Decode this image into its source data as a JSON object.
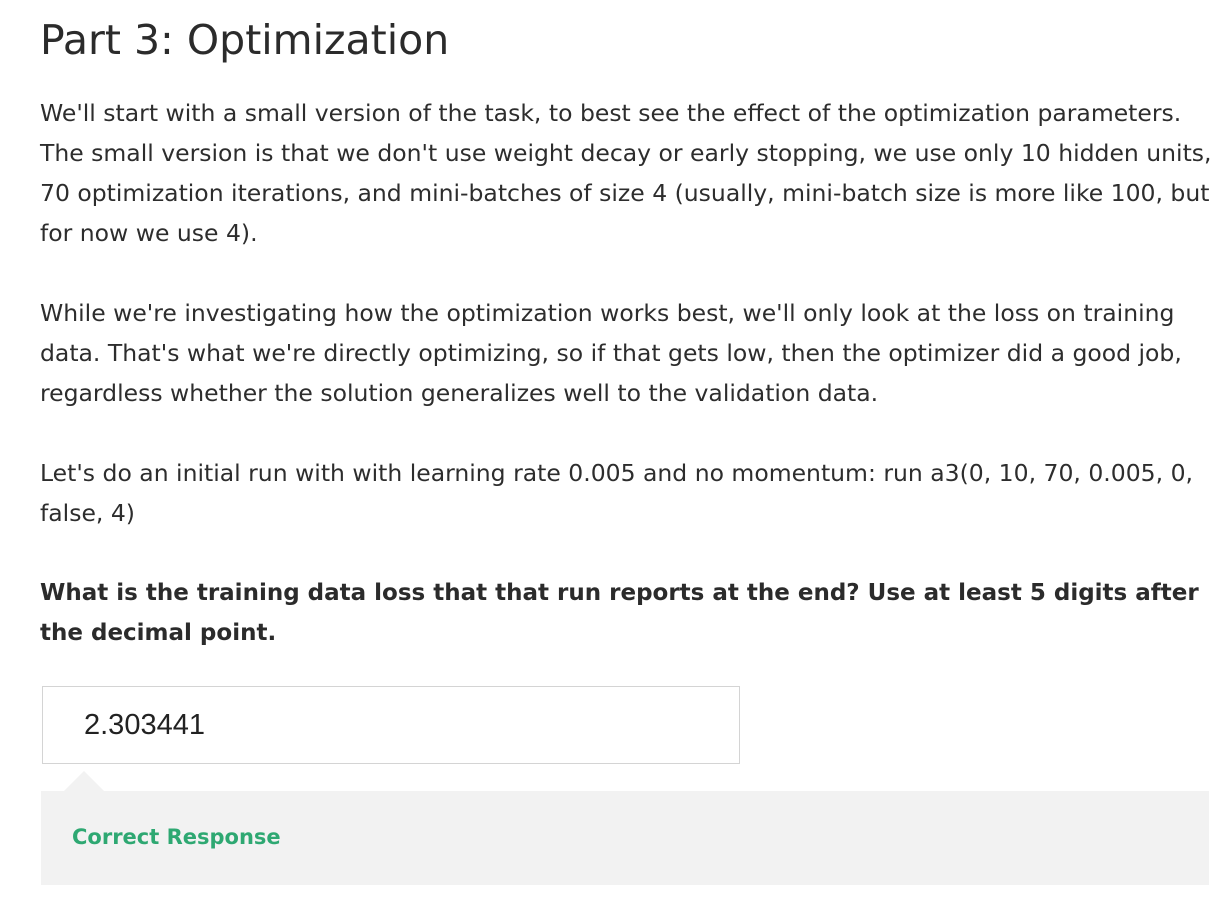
{
  "page": {
    "title": "Part 3: Optimization"
  },
  "content": {
    "paragraph_1": "We'll start with a small version of the task, to best see the effect of the optimization parameters. The small version is that we don't use weight decay or early stopping, we use only 10 hidden units, 70 optimization iterations, and mini-batches of size 4 (usually, mini-batch size is more like 100, but for now we use 4).",
    "paragraph_2": "While we're investigating how the optimization works best, we'll only look at the loss on training data. That's what we're directly optimizing, so if that gets low, then the optimizer did a good job, regardless whether the solution generalizes well to the validation data.",
    "paragraph_3": "Let's do an initial run with with learning rate 0.005 and no momentum: run a3(0, 10, 70, 0.005, 0, false, 4)"
  },
  "question": {
    "prompt": "What is the training data loss that that run reports at the end? Use at least 5 digits after the decimal point.",
    "answer_value": "2.303441"
  },
  "feedback": {
    "label": "Correct Response",
    "color": "#2ea872"
  }
}
